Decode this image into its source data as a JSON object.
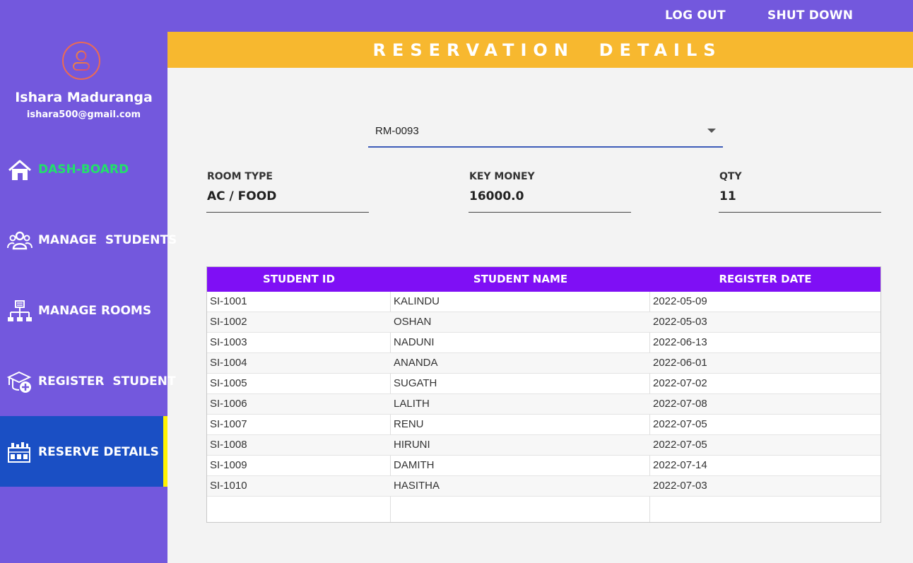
{
  "topbar": {
    "logout_label": "LOG OUT",
    "shutdown_label": "SHUT DOWN"
  },
  "user": {
    "name": "Ishara Maduranga",
    "email": "ishara500@gmail.com"
  },
  "sidebar": {
    "items": [
      {
        "label": "DASH-BOARD",
        "icon": "home-icon",
        "color": "#22e06b"
      },
      {
        "label": "MANAGE  STUDENTS",
        "icon": "users-icon"
      },
      {
        "label": "MANAGE ROOMS",
        "icon": "rooms-icon"
      },
      {
        "label": "REGISTER  STUDENT",
        "icon": "graduation-cap-add-icon"
      },
      {
        "label": "RESERVE DETAILS",
        "icon": "reserve-icon",
        "active": true
      }
    ]
  },
  "page": {
    "title": "RESERVATION  DETAILS"
  },
  "room_select": {
    "value": "RM-0093"
  },
  "fields": {
    "room_type": {
      "label": "ROOM TYPE",
      "value": "AC / FOOD"
    },
    "key_money": {
      "label": "KEY MONEY",
      "value": "16000.0"
    },
    "qty": {
      "label": "QTY",
      "value": "11"
    }
  },
  "table": {
    "headers": [
      "STUDENT ID",
      "STUDENT NAME",
      "REGISTER DATE"
    ],
    "rows": [
      [
        "SI-1001",
        "KALINDU",
        "2022-05-09"
      ],
      [
        "SI-1002",
        "OSHAN",
        "2022-05-03"
      ],
      [
        "SI-1003",
        "NADUNI",
        "2022-06-13"
      ],
      [
        "SI-1004",
        "ANANDA",
        "2022-06-01"
      ],
      [
        "SI-1005",
        "SUGATH",
        "2022-07-02"
      ],
      [
        "SI-1006",
        "LALITH",
        "2022-07-08"
      ],
      [
        "SI-1007",
        "RENU",
        "2022-07-05"
      ],
      [
        "SI-1008",
        "HIRUNI",
        "2022-07-05"
      ],
      [
        "SI-1009",
        "DAMITH",
        "2022-07-14"
      ],
      [
        "SI-1010",
        "HASITHA",
        "2022-07-03"
      ]
    ]
  },
  "colors": {
    "sidebar": "#7358dd",
    "banner": "#f7b82f",
    "table_header": "#7f0ff5",
    "active_nav": "#1a4fc4",
    "active_indicator": "#fff200"
  }
}
